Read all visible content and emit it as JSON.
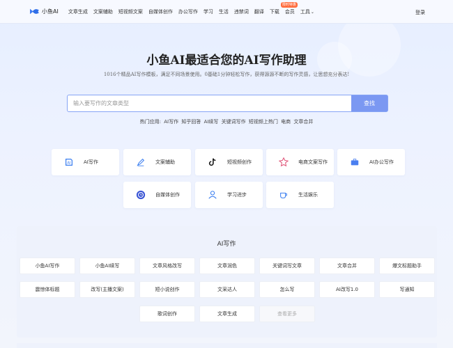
{
  "header": {
    "logo_text": "小鱼AI",
    "nav": [
      "文章生成",
      "文案辅助",
      "短视频文案",
      "自媒体创作",
      "办公写作",
      "学习",
      "生活",
      "违禁词",
      "翻译",
      "下载",
      "会员",
      "工具"
    ],
    "vip_badge": "限时特惠",
    "login": "登录"
  },
  "hero": {
    "title": "小鱼AI最适合您的AI写作助理",
    "subtitle": "1016个精品AI写作模板，满足不同场景使用。0基础1分钟轻松写作，获得源源不断的写作灵感，让思想充分表达!"
  },
  "search": {
    "placeholder": "输入要写作的文章类型",
    "button": "查找"
  },
  "hot": {
    "label": "热门应用:",
    "items": [
      "AI写作",
      "知乎回答",
      "AI续写",
      "关键词写作",
      "短视频上热门",
      "电商",
      "文章合并"
    ]
  },
  "categories": [
    {
      "label": "AI写作",
      "icon": "ai-writing-icon"
    },
    {
      "label": "文案辅助",
      "icon": "pen-icon"
    },
    {
      "label": "短视频创作",
      "icon": "tiktok-icon"
    },
    {
      "label": "电商文案写作",
      "icon": "shopping-icon"
    },
    {
      "label": "AI办公写作",
      "icon": "briefcase-icon"
    },
    {
      "label": "自媒体创作",
      "icon": "clock-icon"
    },
    {
      "label": "学习进步",
      "icon": "user-icon"
    },
    {
      "label": "生活娱乐",
      "icon": "cup-icon"
    }
  ],
  "panel": {
    "title": "AI写作",
    "tools": [
      "小鱼AI写作",
      "小鱼AI续写",
      "文章风格改写",
      "文章润色",
      "关键词写文章",
      "文章合并",
      "爆文标题助手",
      "震惊体标题",
      "改写(主播文案)",
      "短小说创作",
      "文采达人",
      "怎么写",
      "AI改写1.0",
      "写通知",
      "歌词创作",
      "文章生成",
      "查看更多"
    ]
  },
  "colors": {
    "accent": "#7b98f2",
    "border": "#86a4f5",
    "badge": "#ff6a3a"
  }
}
